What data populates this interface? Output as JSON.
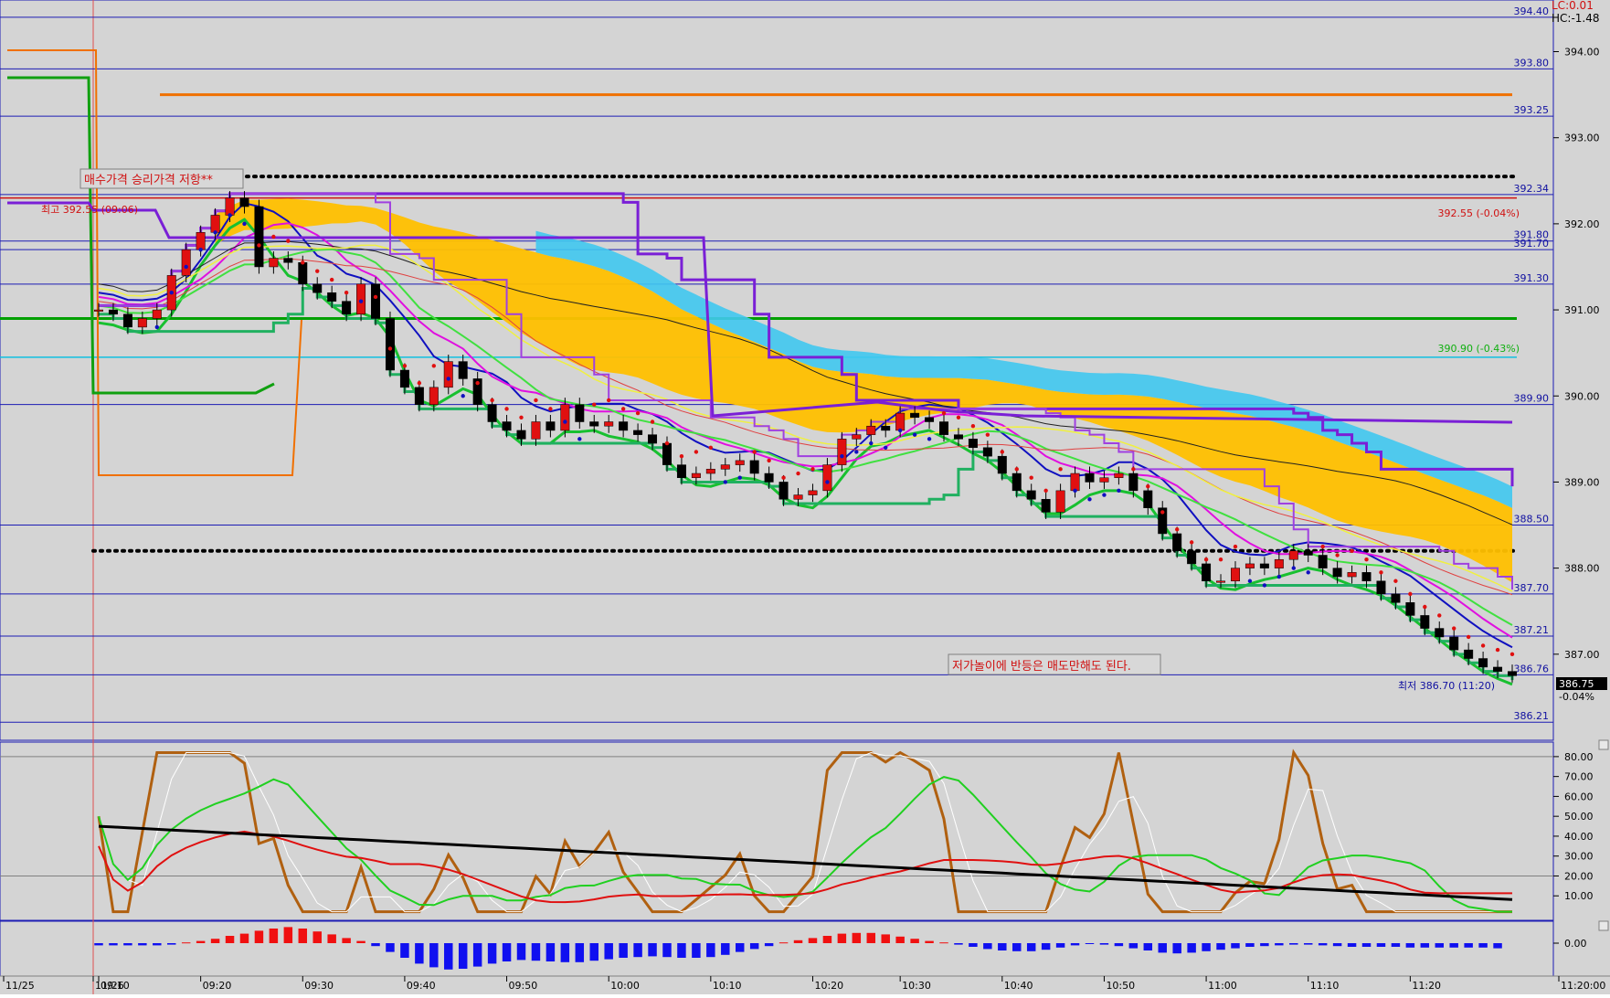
{
  "indicators": {
    "lc": "LC:0.01",
    "hc": "HC:-1.48"
  },
  "colors": {
    "bg": "#d4d4d4",
    "grid_blue": "#1c1cb4",
    "up": "#e01010",
    "down": "#000000",
    "cloud_gold": "#ffc000",
    "cloud_cyan": "#40c8f0",
    "purple": "#7a1fd6",
    "green": "#00a000",
    "orange": "#f07000",
    "label_blue": "#1010a0",
    "label_red": "#d01010"
  },
  "price_levels": [
    "394.40",
    "393.80",
    "393.25",
    "392.34",
    "391.80",
    "391.70",
    "391.30",
    "389.90",
    "388.50",
    "387.70",
    "387.21",
    "386.76",
    "386.21"
  ],
  "special_labels": {
    "high_right": "392.55 (-0.04%)",
    "green_level": "390.90 (-0.43%)",
    "high_left": "최고 392.55 (09:06)",
    "low_right": "최저 386.70 (11:20)",
    "current_price": "386.75",
    "current_change": "-0.04%"
  },
  "annotations": {
    "resistance": "매수가격 승리가격 저항**",
    "bottom_note": "저가놀이에 반등은 매도만해도 된다."
  },
  "chart_data": [
    {
      "type": "line",
      "title": "",
      "series_kind": "candlestick",
      "ylim": [
        386.0,
        394.6
      ],
      "y_ticks": [
        "394.00",
        "393.00",
        "392.00",
        "391.00",
        "390.00",
        "389.00",
        "388.00",
        "387.00"
      ],
      "x_labels": [
        "11/25",
        "11/26",
        "09:10",
        "09:20",
        "09:30",
        "09:40",
        "09:50",
        "10:00",
        "10:10",
        "10:20",
        "10:30",
        "10:40",
        "10:50",
        "11:00",
        "11:10",
        "11:20",
        "11:20:00"
      ],
      "close": [
        391.0,
        390.95,
        390.8,
        390.9,
        391.0,
        391.4,
        391.7,
        391.9,
        392.1,
        392.3,
        392.2,
        391.5,
        391.6,
        391.55,
        391.3,
        391.2,
        391.1,
        390.95,
        391.3,
        390.9,
        390.3,
        390.1,
        389.9,
        390.1,
        390.4,
        390.2,
        389.9,
        389.7,
        389.6,
        389.5,
        389.7,
        389.6,
        389.9,
        389.7,
        389.65,
        389.7,
        389.6,
        389.55,
        389.45,
        389.2,
        389.05,
        389.1,
        389.15,
        389.2,
        389.25,
        389.1,
        389.0,
        388.8,
        388.85,
        388.9,
        389.2,
        389.5,
        389.55,
        389.65,
        389.6,
        389.8,
        389.75,
        389.7,
        389.55,
        389.5,
        389.4,
        389.3,
        389.1,
        388.9,
        388.8,
        388.65,
        388.9,
        389.1,
        389.0,
        389.05,
        389.1,
        388.9,
        388.7,
        388.4,
        388.2,
        388.05,
        387.85,
        387.85,
        388.0,
        388.05,
        388.0,
        388.1,
        388.2,
        388.15,
        388.0,
        387.9,
        387.95,
        387.85,
        387.7,
        387.6,
        387.45,
        387.3,
        387.2,
        387.05,
        386.95,
        386.85,
        386.8,
        386.75
      ]
    },
    {
      "type": "line",
      "title": "",
      "ylim": [
        0,
        85
      ],
      "y_ticks": [
        "80.00",
        "70.00",
        "60.00",
        "50.00",
        "40.00",
        "30.00",
        "20.00",
        "10.00"
      ]
    },
    {
      "type": "bar",
      "title": "",
      "y_ticks": [
        "0.00"
      ],
      "values": [
        -0.3,
        -0.3,
        -0.3,
        -0.3,
        -0.3,
        -0.2,
        0.1,
        0.3,
        0.6,
        1.0,
        1.3,
        1.7,
        2.0,
        2.2,
        2.0,
        1.6,
        1.2,
        0.7,
        0.3,
        -0.4,
        -1.2,
        -2.0,
        -2.8,
        -3.3,
        -3.6,
        -3.5,
        -3.2,
        -2.8,
        -2.5,
        -2.3,
        -2.4,
        -2.5,
        -2.6,
        -2.6,
        -2.4,
        -2.2,
        -2.0,
        -1.9,
        -1.8,
        -1.9,
        -2.0,
        -2.0,
        -1.9,
        -1.6,
        -1.2,
        -0.8,
        -0.4,
        0.1,
        0.4,
        0.7,
        1.0,
        1.3,
        1.4,
        1.4,
        1.2,
        0.9,
        0.6,
        0.3,
        0.1,
        -0.2,
        -0.5,
        -0.8,
        -1.0,
        -1.1,
        -1.1,
        -0.9,
        -0.6,
        -0.3,
        -0.1,
        -0.2,
        -0.4,
        -0.7,
        -1.0,
        -1.3,
        -1.4,
        -1.3,
        -1.1,
        -0.9,
        -0.7,
        -0.5,
        -0.4,
        -0.3,
        -0.2,
        -0.2,
        -0.3,
        -0.4,
        -0.5,
        -0.5,
        -0.5,
        -0.5,
        -0.6,
        -0.6,
        -0.6,
        -0.6,
        -0.6,
        -0.6,
        -0.7
      ]
    }
  ]
}
